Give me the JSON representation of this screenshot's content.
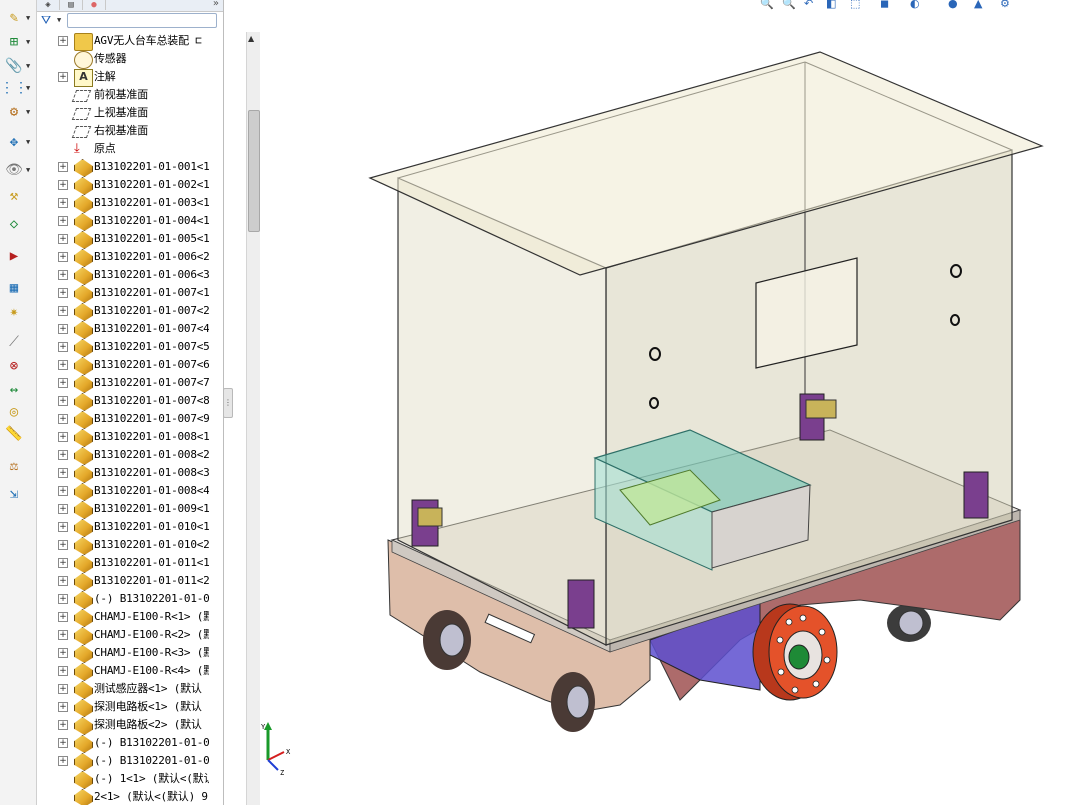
{
  "feature_tree": {
    "tabs": [
      "feature-manager",
      "property-manager",
      "appearance"
    ],
    "filter": {
      "value": ""
    },
    "items": [
      {
        "label": "AGV无人台车总装配 ⊏",
        "icon": "folder-icon",
        "expandable": true
      },
      {
        "label": "传感器",
        "icon": "sensor-icon",
        "expandable": false
      },
      {
        "label": "注解",
        "icon": "annotation-icon",
        "expandable": true
      },
      {
        "label": "前视基准面",
        "icon": "plane-icon",
        "expandable": false
      },
      {
        "label": "上视基准面",
        "icon": "plane-icon",
        "expandable": false
      },
      {
        "label": "右视基准面",
        "icon": "plane-icon",
        "expandable": false
      },
      {
        "label": "原点",
        "icon": "origin-icon",
        "expandable": false
      },
      {
        "label": "B13102201-01-001<1>",
        "icon": "part-icon",
        "expandable": true
      },
      {
        "label": "B13102201-01-002<1>",
        "icon": "part-icon",
        "expandable": true
      },
      {
        "label": "B13102201-01-003<1>",
        "icon": "part-icon",
        "expandable": true
      },
      {
        "label": "B13102201-01-004<1>",
        "icon": "part-icon",
        "expandable": true
      },
      {
        "label": "B13102201-01-005<1>",
        "icon": "part-icon",
        "expandable": true
      },
      {
        "label": "B13102201-01-006<2>",
        "icon": "part-icon",
        "expandable": true
      },
      {
        "label": "B13102201-01-006<3>",
        "icon": "part-icon",
        "expandable": true
      },
      {
        "label": "B13102201-01-007<1>",
        "icon": "part-icon",
        "expandable": true
      },
      {
        "label": "B13102201-01-007<2>",
        "icon": "part-icon",
        "expandable": true
      },
      {
        "label": "B13102201-01-007<4>",
        "icon": "part-icon",
        "expandable": true
      },
      {
        "label": "B13102201-01-007<5>",
        "icon": "part-icon",
        "expandable": true
      },
      {
        "label": "B13102201-01-007<6>",
        "icon": "part-icon",
        "expandable": true
      },
      {
        "label": "B13102201-01-007<7>",
        "icon": "part-icon",
        "expandable": true
      },
      {
        "label": "B13102201-01-007<8>",
        "icon": "part-icon",
        "expandable": true
      },
      {
        "label": "B13102201-01-007<9>",
        "icon": "part-icon",
        "expandable": true
      },
      {
        "label": "B13102201-01-008<1>",
        "icon": "part-icon",
        "expandable": true
      },
      {
        "label": "B13102201-01-008<2>",
        "icon": "part-icon",
        "expandable": true
      },
      {
        "label": "B13102201-01-008<3>",
        "icon": "part-icon",
        "expandable": true
      },
      {
        "label": "B13102201-01-008<4>",
        "icon": "part-icon",
        "expandable": true
      },
      {
        "label": "B13102201-01-009<1>",
        "icon": "part-icon",
        "expandable": true
      },
      {
        "label": "B13102201-01-010<1>",
        "icon": "part-icon",
        "expandable": true
      },
      {
        "label": "B13102201-01-010<2>",
        "icon": "part-icon",
        "expandable": true
      },
      {
        "label": "B13102201-01-011<1>",
        "icon": "part-icon",
        "expandable": true
      },
      {
        "label": "B13102201-01-011<2>",
        "icon": "part-icon",
        "expandable": true
      },
      {
        "label": "(-) B13102201-01-01",
        "icon": "part-icon",
        "expandable": true
      },
      {
        "label": "CHAMJ-E100-R<1> (默",
        "icon": "part-icon",
        "expandable": true
      },
      {
        "label": "CHAMJ-E100-R<2> (默",
        "icon": "part-icon",
        "expandable": true
      },
      {
        "label": "CHAMJ-E100-R<3> (默",
        "icon": "part-icon",
        "expandable": true
      },
      {
        "label": "CHAMJ-E100-R<4> (默",
        "icon": "part-icon",
        "expandable": true
      },
      {
        "label": "测试感应器<1> (默认",
        "icon": "part-icon",
        "expandable": true
      },
      {
        "label": "探测电路板<1> (默认",
        "icon": "part-icon",
        "expandable": true
      },
      {
        "label": "探测电路板<2> (默认",
        "icon": "part-icon",
        "expandable": true
      },
      {
        "label": "(-) B13102201-01-01",
        "icon": "part-icon",
        "expandable": true
      },
      {
        "label": "(-) B13102201-01-01",
        "icon": "part-icon",
        "expandable": true
      },
      {
        "label": "(-) 1<1> (默认<(默认",
        "icon": "part-icon",
        "expandable": false
      },
      {
        "label": "2<1> (默认<(默认) 9",
        "icon": "part-icon",
        "expandable": false
      }
    ]
  },
  "command_toolbar": {
    "icons": [
      "edit-component-icon",
      "insert-components-icon",
      "mate-icon",
      "linear-pattern-icon",
      "smart-fasteners-icon",
      "move-component-icon",
      "show-hidden-icon",
      "assembly-features-icon",
      "reference-geometry-icon",
      "new-motion-study-icon",
      "bill-of-materials-icon",
      "exploded-view-icon",
      "explode-line-sketch-icon",
      "interference-detection-icon",
      "clearance-verification-icon",
      "hole-alignment-icon",
      "measure-icon",
      "mass-properties-icon",
      "instant3d-icon"
    ]
  },
  "heads_up_toolbar": {
    "icons": [
      "zoom-to-fit-icon",
      "zoom-to-area-icon",
      "previous-view-icon",
      "section-view-icon",
      "view-orientation-icon",
      "display-style-icon",
      "hide-show-icon",
      "edit-appearance-icon",
      "apply-scene-icon",
      "view-settings-icon"
    ]
  },
  "viewport": {
    "model": "agv-cart-assembly",
    "colors": {
      "enclosure": "#e8e4cc",
      "base_plate": "#ebe7e2",
      "chassis_front": "#d8b39b",
      "chassis_side": "#ad6b6b",
      "drive_wheel": "#e4522a",
      "electronics_box": "#6fc6b7",
      "bracket": "#7a3f8e"
    }
  },
  "triad": {
    "x_label": "X",
    "y_label": "Y",
    "z_label": "Z"
  }
}
